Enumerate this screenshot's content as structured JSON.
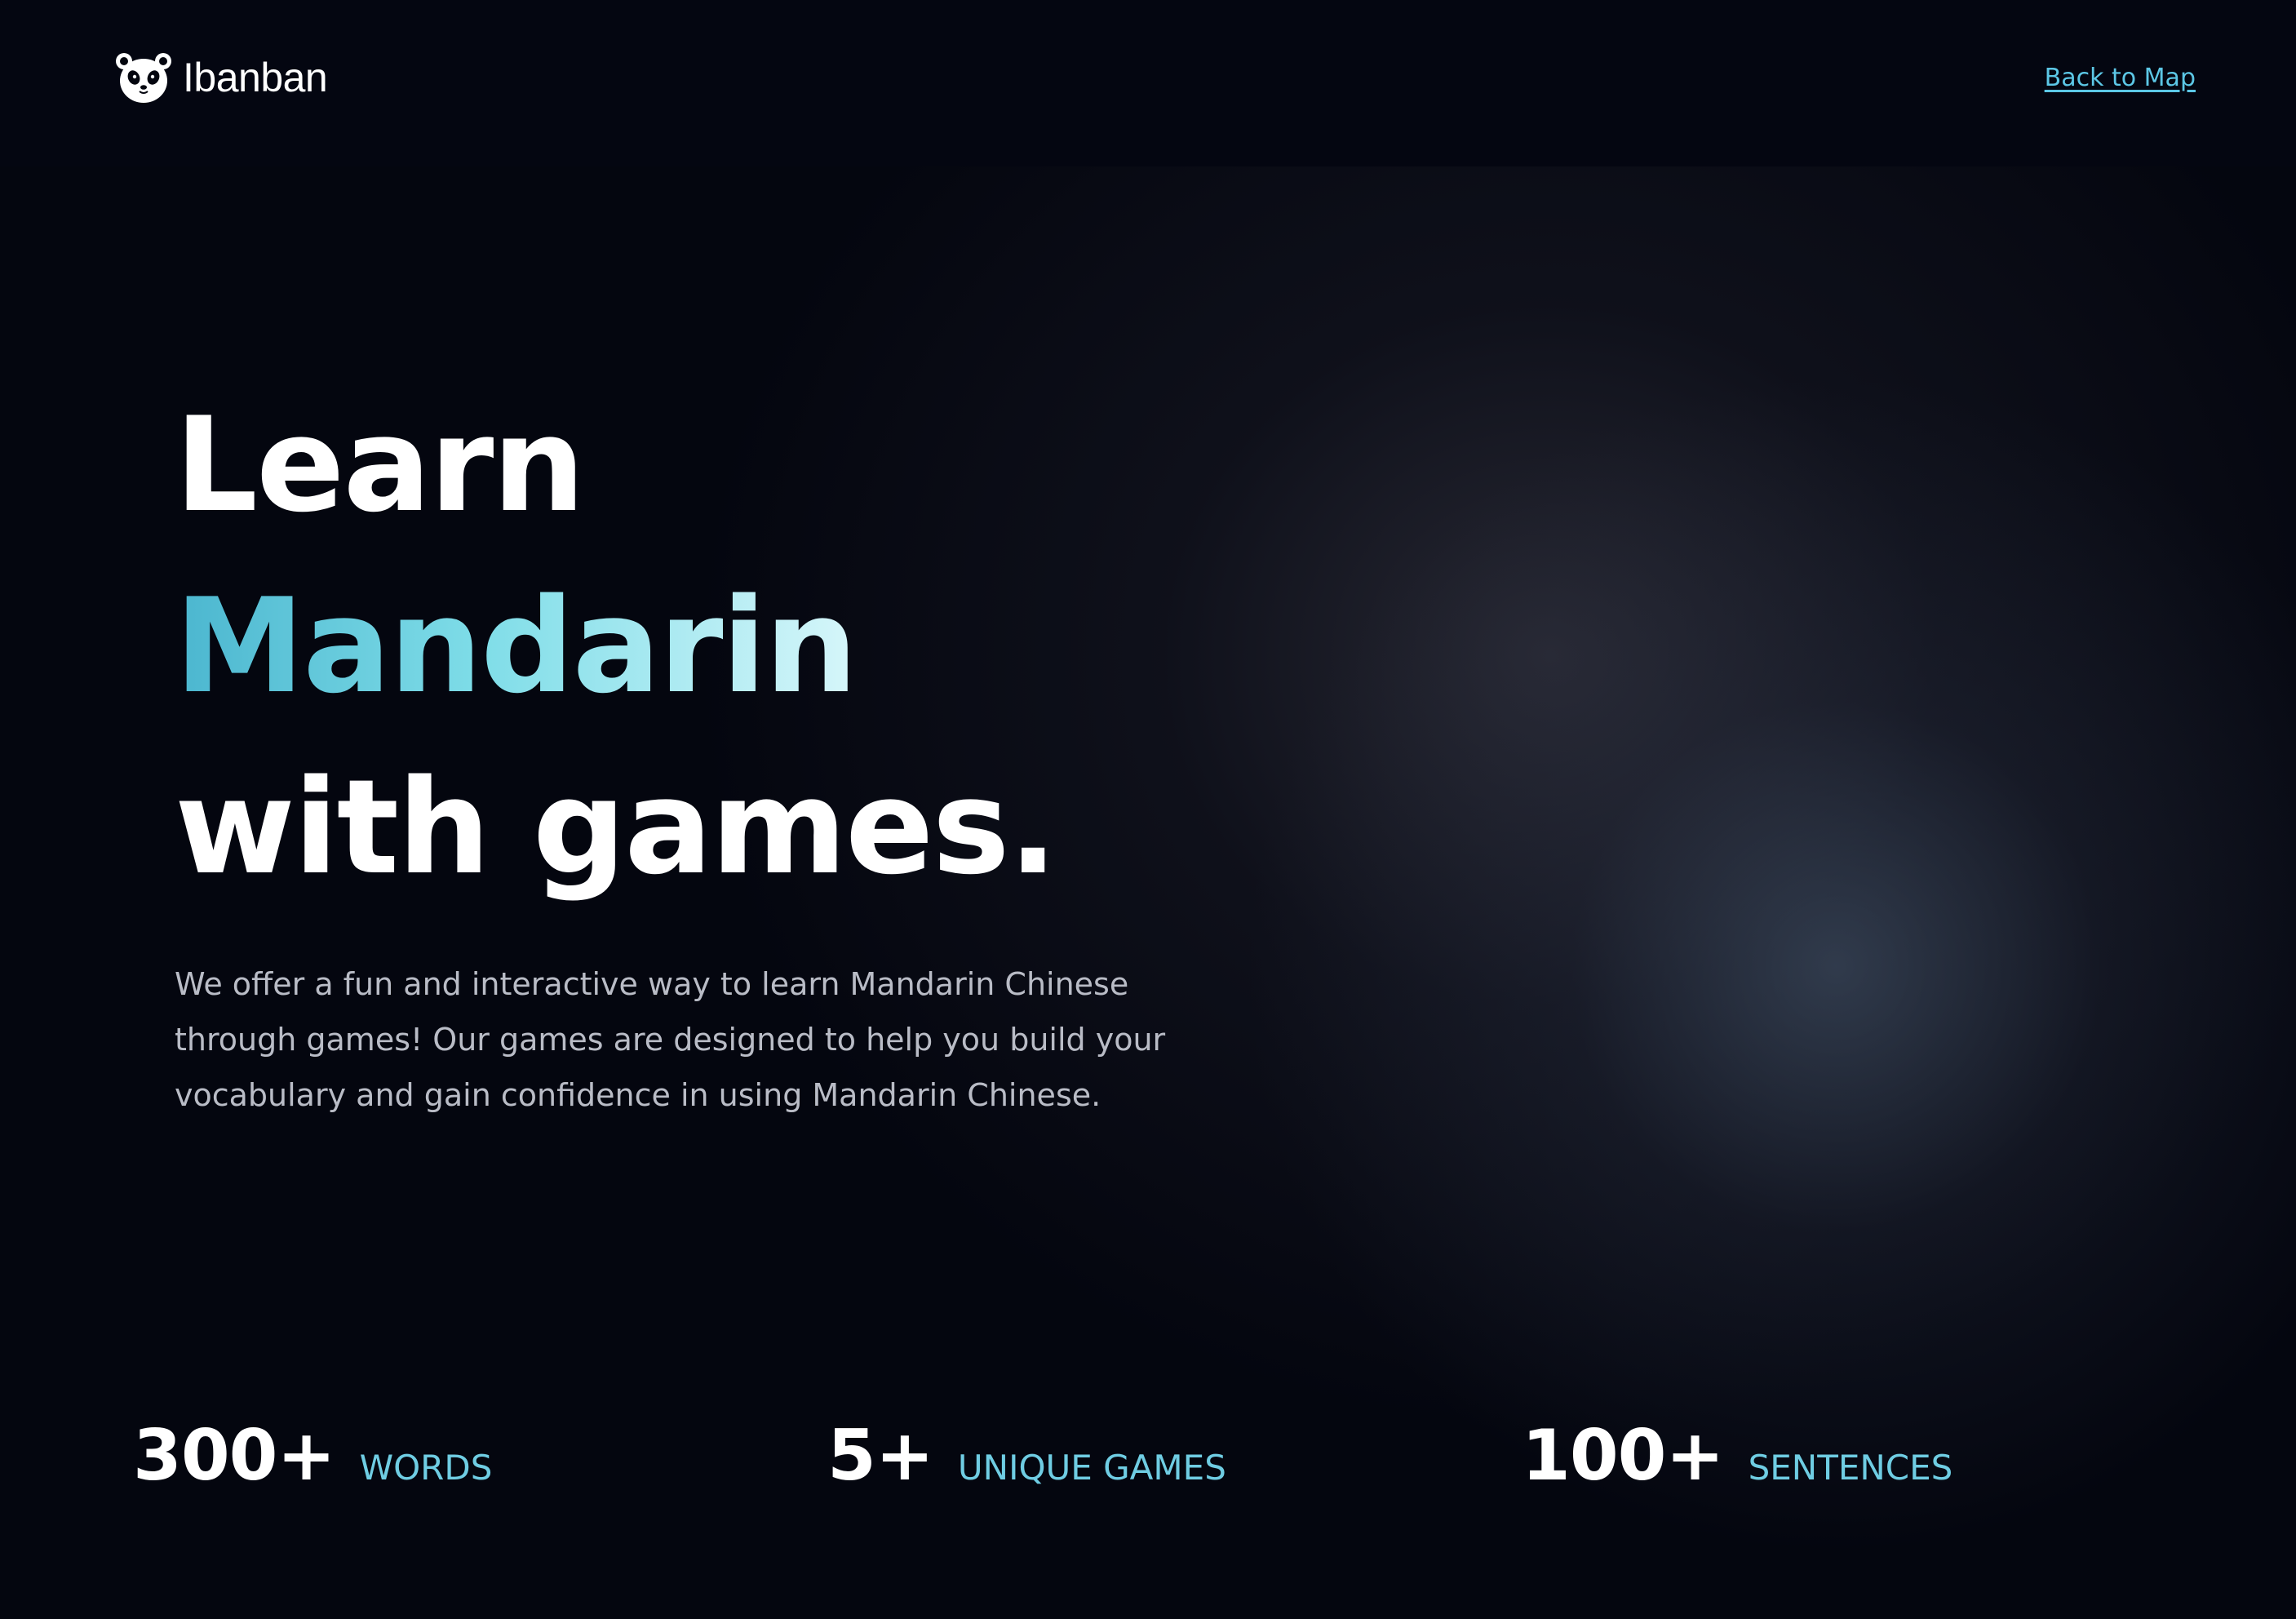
{
  "header": {
    "brand_name": "Ibanban",
    "brand_icon": "panda-icon",
    "back_link": "Back to Map"
  },
  "hero": {
    "headline_line1": "Learn",
    "headline_line2": "Mandarin",
    "headline_line3": "with games.",
    "description": "We offer a fun and interactive way to learn Mandarin Chinese through games! Our games are designed to help you build your vocabulary and gain confidence in using Mandarin Chinese."
  },
  "stats": [
    {
      "value": "300+",
      "label": "WORDS"
    },
    {
      "value": "5+",
      "label": "UNIQUE GAMES"
    },
    {
      "value": "100+",
      "label": "SENTENCES"
    }
  ],
  "colors": {
    "background": "#03050d",
    "accent": "#5cc7e6",
    "gradient_start": "#4bb6cf",
    "gradient_end": "#d6f6fa",
    "body_text": "#b9bcc6"
  }
}
